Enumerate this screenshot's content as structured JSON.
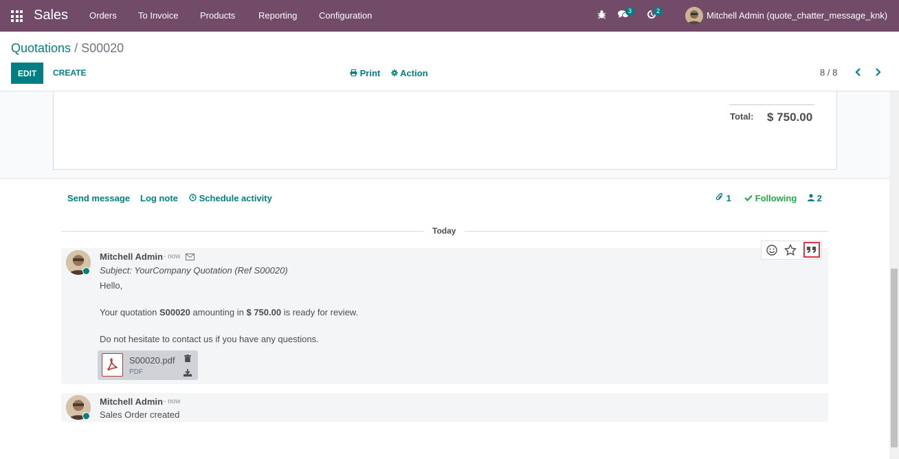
{
  "navbar": {
    "app_name": "Sales",
    "menu": [
      "Orders",
      "To Invoice",
      "Products",
      "Reporting",
      "Configuration"
    ],
    "messages_count": "3",
    "activities_count": "2",
    "user_name": "Mitchell Admin (quote_chatter_message_knk)"
  },
  "breadcrumb": {
    "parent": "Quotations",
    "separator": "/",
    "current": "S00020"
  },
  "buttons": {
    "edit": "EDIT",
    "create": "CREATE",
    "print": "Print",
    "action": "Action"
  },
  "pager": {
    "value": "8 / 8"
  },
  "totals": {
    "label": "Total:",
    "amount": "$ 750.00"
  },
  "chatter": {
    "send_message": "Send message",
    "log_note": "Log note",
    "schedule_activity": "Schedule activity",
    "attachments_count": "1",
    "following": "Following",
    "followers_count": "2",
    "date_separator": "Today"
  },
  "messages": [
    {
      "author": "Mitchell Admin",
      "date": "- now",
      "subject": "Subject: YourCompany Quotation (Ref S00020)",
      "greeting": "Hello,",
      "line1_pre": "Your quotation ",
      "line1_ref": "S00020",
      "line1_mid": " amounting in ",
      "line1_amount": "$ 750.00",
      "line1_post": " is ready for review.",
      "line2": "Do not hesitate to contact us if you have any questions.",
      "attachment": {
        "name": "S00020.pdf",
        "type": "PDF"
      }
    },
    {
      "author": "Mitchell Admin",
      "date": "- now",
      "body": "Sales Order created"
    }
  ],
  "colors": {
    "brand": "#714b67",
    "accent": "#017e84",
    "following": "#28a745",
    "highlight": "#dc3545"
  },
  "icons": [
    "apps-icon",
    "bug-icon",
    "chat-icon",
    "activity-icon",
    "print-icon",
    "gear-icon",
    "chevron-left-icon",
    "chevron-right-icon",
    "paperclip-icon",
    "check-icon",
    "user-icon",
    "clock-icon",
    "envelope-icon",
    "smile-icon",
    "star-icon",
    "quote-icon",
    "pdf-icon",
    "trash-icon",
    "download-icon"
  ]
}
